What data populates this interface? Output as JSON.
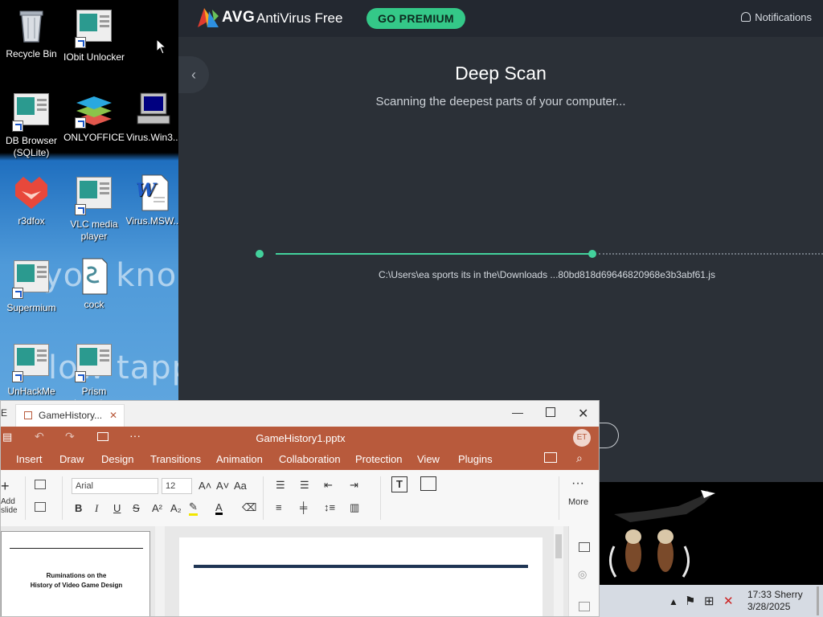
{
  "desktop": {
    "icons": [
      {
        "label": "Recycle Bin"
      },
      {
        "label": "IObit Unlocker"
      },
      {
        "label": "DB Browser (SQLite)"
      },
      {
        "label": "ONLYOFFICE"
      },
      {
        "label": "Virus.Win3..."
      },
      {
        "label": "r3dfox"
      },
      {
        "label": "VLC media player"
      },
      {
        "label": "Virus.MSW..."
      },
      {
        "label": "Supermium"
      },
      {
        "label": "cock"
      },
      {
        "label": "UnHackMe"
      },
      {
        "label": "Prism Launcher"
      }
    ],
    "wallpaper_text": [
      "you know",
      "low tapp"
    ]
  },
  "avg": {
    "brand": "AVG",
    "product": "AntiVirus Free",
    "go_premium": "GO PREMIUM",
    "notifications": "Notifications",
    "back": "‹",
    "scan_title": "Deep Scan",
    "scan_subtitle": "Scanning the deepest parts of your computer...",
    "progress_fraction": 0.58,
    "scan_path": "C:\\Users\\ea sports its in the\\Downloads  ...80bd818d69646820968e3b3abf61.js",
    "accent": "#43d19c"
  },
  "onlyoffice": {
    "tab_title": "GameHistory...",
    "file_title": "GameHistory1.pptx",
    "avatar": "ET",
    "menu": [
      "Insert",
      "Draw",
      "Design",
      "Transitions",
      "Animation",
      "Collaboration",
      "Protection",
      "View",
      "Plugins"
    ],
    "font_name": "Arial",
    "font_size": "12",
    "more_label": "More",
    "add_slide_label": "Add slide",
    "thumb_title_1": "Ruminations on the",
    "thumb_title_2": "History of Video Game Design",
    "accent": "#b85a3c"
  },
  "taskbar": {
    "time": "17:33",
    "user": "Sherry",
    "date": "3/28/2025"
  }
}
